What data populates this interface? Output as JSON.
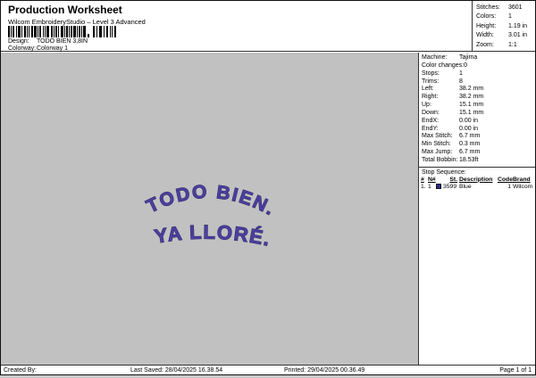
{
  "header": {
    "title": "Production Worksheet",
    "subtitle": "Wilcom EmbroideryStudio – Level 3 Advanced",
    "design_label": "Design:",
    "design_value": "TODO BIEN 3,8IN",
    "colorway_label": "Colorway:",
    "colorway_value": "Colorway 1"
  },
  "summary": {
    "rows": [
      {
        "label": "Stitches:",
        "value": "3601"
      },
      {
        "label": "Colors:",
        "value": "1"
      },
      {
        "label": "Height:",
        "value": "1.19 in"
      },
      {
        "label": "Width:",
        "value": "3.01 in"
      },
      {
        "label": "Zoom:",
        "value": "1:1"
      }
    ]
  },
  "machine": {
    "rows": [
      {
        "label": "Machine:",
        "value": "Tajima"
      },
      {
        "label": "Color changes:",
        "value": "0"
      },
      {
        "label": "Stops:",
        "value": "1"
      },
      {
        "label": "Trims:",
        "value": "8"
      },
      {
        "label": "Left:",
        "value": "38.2 mm"
      },
      {
        "label": "Right:",
        "value": "38.2 mm"
      },
      {
        "label": "Up:",
        "value": "15.1 mm"
      },
      {
        "label": "Down:",
        "value": "15.1 mm"
      },
      {
        "label": "EndX:",
        "value": "0.00 in"
      },
      {
        "label": "EndY:",
        "value": "0.00 in"
      },
      {
        "label": "Max Stitch:",
        "value": "6.7 mm"
      },
      {
        "label": "Min Stitch:",
        "value": "0.3 mm"
      },
      {
        "label": "Max Jump:",
        "value": "6.7 mm"
      },
      {
        "label": "Total Bobbin:",
        "value": "18.53ft"
      }
    ]
  },
  "stop_sequence": {
    "title": "Stop Sequence:",
    "columns": {
      "num": "#",
      "n": "N#",
      "st": "St.",
      "description": "Description",
      "code": "Code",
      "brand": "Brand"
    },
    "rows": [
      {
        "num": "1.",
        "n": "1",
        "st": "3599",
        "description": "Blue",
        "code": "1",
        "brand": "Wilcom",
        "swatch_color": "#2b2b8a"
      }
    ]
  },
  "design": {
    "line1": "TODO BIEN.",
    "line2": "YA LLORÉ.",
    "thread_color": "#4b3f9e",
    "outline_color": "#272063",
    "canvas_color": "#c1c1c1"
  },
  "footer": {
    "created_by": "Created By:",
    "last_saved": "Last Saved: 28/04/2025 16.38.54",
    "printed": "Printed: 29/04/2025 00.36.49",
    "page": "Page 1 of 1"
  }
}
